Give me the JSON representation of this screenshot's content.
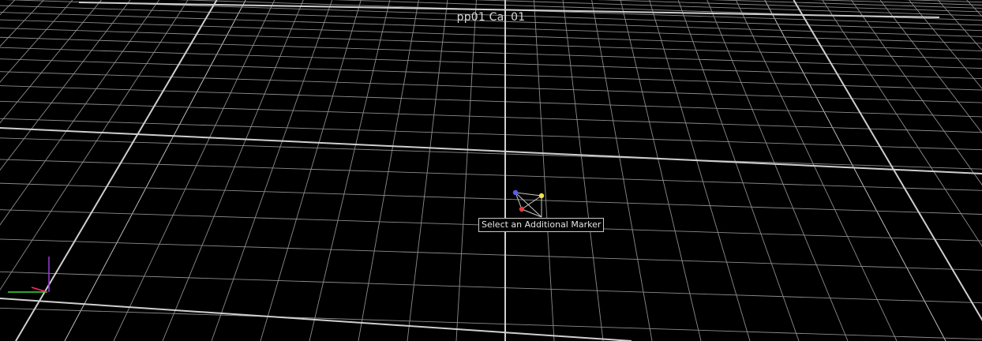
{
  "viewport": {
    "title": "pp01 Cal 01",
    "tooltip": "Select an Additional Marker",
    "background": "#000000",
    "grid_color": "#8c8c8c",
    "major_grid_color": "#cfcfcf"
  },
  "markers": [
    {
      "name": "marker-blue",
      "color": "#5a5cf0"
    },
    {
      "name": "marker-yellow",
      "color": "#f2e14a"
    },
    {
      "name": "marker-red",
      "color": "#e83c3c"
    }
  ],
  "axis_gizmo": {
    "x_color": "#ff2a6a",
    "y_color": "#3adb3a",
    "z_color": "#9a3adb"
  }
}
